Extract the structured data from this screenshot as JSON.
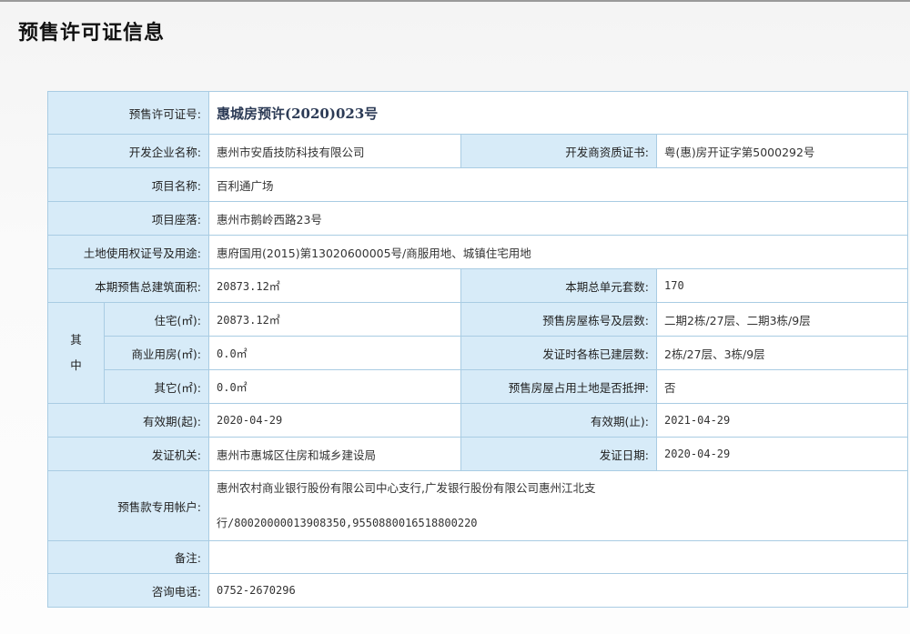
{
  "title": "预售许可证信息",
  "rows": {
    "permit": {
      "label": "预售许可证号:",
      "value": "惠城房预许(2020)023号"
    },
    "developer": {
      "label": "开发企业名称:",
      "value": "惠州市安盾技防科技有限公司"
    },
    "qualification": {
      "label": "开发商资质证书:",
      "value": "粤(惠)房开证字第5000292号"
    },
    "project_name": {
      "label": "项目名称:",
      "value": "百利通广场"
    },
    "project_location": {
      "label": "项目座落:",
      "value": "惠州市鹅岭西路23号"
    },
    "land_use": {
      "label": "土地使用权证号及用途:",
      "value": "惠府国用(2015)第13020600005号/商服用地、城镇住宅用地"
    },
    "total_area": {
      "label": "本期预售总建筑面积:",
      "value": "20873.12㎡"
    },
    "total_units": {
      "label": "本期总单元套数:",
      "value": "170"
    },
    "side_label": {
      "line1": "其",
      "line2": "中"
    },
    "residential": {
      "label": "住宅(㎡):",
      "value": "20873.12㎡"
    },
    "buildings_floors": {
      "label": "预售房屋栋号及层数:",
      "value": "二期2栋/27层、二期3栋/9层"
    },
    "commercial": {
      "label": "商业用房(㎡):",
      "value": "0.0㎡"
    },
    "built_floors": {
      "label": "发证时各栋已建层数:",
      "value": "2栋/27层、3栋/9层"
    },
    "other": {
      "label": "其它(㎡):",
      "value": "0.0㎡"
    },
    "mortgage": {
      "label": "预售房屋占用土地是否抵押:",
      "value": "否"
    },
    "valid_from": {
      "label": "有效期(起):",
      "value": "2020-04-29"
    },
    "valid_to": {
      "label": "有效期(止):",
      "value": "2021-04-29"
    },
    "issuer": {
      "label": "发证机关:",
      "value": "惠州市惠城区住房和城乡建设局"
    },
    "issue_date": {
      "label": "发证日期:",
      "value": "2020-04-29"
    },
    "account": {
      "label": "预售款专用帐户:",
      "line1": "惠州农村商业银行股份有限公司中心支行,广发银行股份有限公司惠州江北支",
      "line2": "行/80020000013908350,9550880016518800220"
    },
    "remarks": {
      "label": "备注:",
      "value": ""
    },
    "phone": {
      "label": "咨询电话:",
      "value": "0752-2670296"
    }
  }
}
